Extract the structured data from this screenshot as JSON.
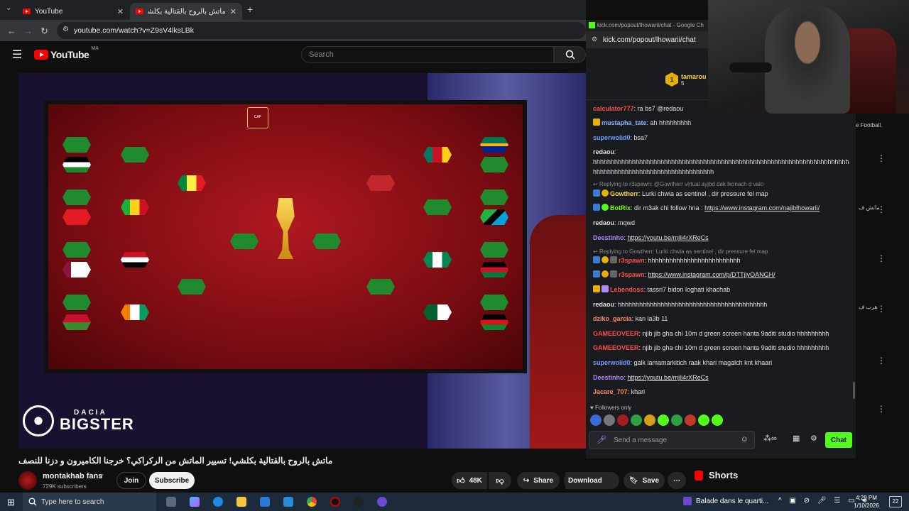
{
  "browser": {
    "tabs": [
      {
        "title": "YouTube"
      },
      {
        "title": "ماتش بالروح بالقتالية بكلشي! تس..."
      }
    ],
    "new_tab": "+",
    "url": "youtube.com/watch?v=Z9sV4lksLBk"
  },
  "youtube": {
    "logo": "YouTube",
    "country": "MA",
    "search_placeholder": "Search",
    "video": {
      "title": "ماتش بالروح بالقتالية بكلشي! تسيير الماتش من الركراكي؟ خرجنا الكاميرون و دزنا للنصف",
      "overlay_brand": "BIGSTER",
      "overlay_brand_small": "DACIA"
    },
    "channel": {
      "name": "montakhab fans",
      "subscribers": "729K subscribers"
    },
    "buttons": {
      "join": "Join",
      "subscribe": "Subscribe",
      "likes": "48K",
      "share": "Share",
      "download": "Download",
      "save": "Save"
    },
    "shorts_label": "Shorts"
  },
  "chat_window": {
    "title": "kick.com/popout/lhowarii/chat - Google Ch",
    "url": "kick.com/popout/lhowarii/chat",
    "top_user": {
      "name": "tamarou",
      "rank": "1",
      "count": "5"
    },
    "messages": [
      {
        "user": "calculator777",
        "color": "#ff4d4d",
        "text": "ra bs7 @redaou"
      },
      {
        "user": "mustapha_tate",
        "color": "#8ab4ff",
        "text": "ah hhhhhhhhh"
      },
      {
        "user": "superwolid0",
        "color": "#6f9dff",
        "text": "bsa7"
      },
      {
        "user": "redaou",
        "color": "#e0e0e0",
        "text": "hhhhhhhhhhhhhhhhhhhhhhhhhhhhhhhhhhhhhhhhhhhhhhhhhhhhhhhhhhhhhhhhhhhhhhhhhhhhhhhhhhhhhhhhhhhhhhhhhhhhhhhhhh"
      },
      {
        "reply": "Replying to r3spawn: @Gowtherr virtual ayjbd dak lkonach d valo",
        "user": "Gowtherr",
        "color": "#ffd54f",
        "text": "Lurki chwia as sentinel , dir pressure fel map"
      },
      {
        "user": "BotRix",
        "color": "#7cfc00",
        "text": "dir m3ak chi follow hna : ",
        "link": "https://www.instagram.com/najiblhowarii/"
      },
      {
        "user": "redaou",
        "color": "#e0e0e0",
        "text": "mqwd"
      },
      {
        "user": "Deestinho",
        "color": "#b388ff",
        "text": "",
        "link": "https://youtu.be/mjli4rXReCs"
      },
      {
        "reply": "Replying to Gowtherr: Lurki chwia as sentinel , dir pressure fel map",
        "user": "r3spawn",
        "color": "#ff4d4d",
        "text": "hhhhhhhhhhhhhhhhhhhhhhhhhh"
      },
      {
        "user": "r3spawn",
        "color": "#ff4d4d",
        "text": "",
        "link": "https://www.instagram.com/p/DTTjjyOANGH/"
      },
      {
        "user": "Lebendoss",
        "color": "#ff4d4d",
        "text": "tassri7 bidon loghati khachab"
      },
      {
        "user": "redaou",
        "color": "#e0e0e0",
        "text": "hhhhhhhhhhhhhhhhhhhhhhhhhhhhhhhhhhhhhhhhhh"
      },
      {
        "user": "dziko_garcia",
        "color": "#ff8a65",
        "text": "kan la3b 11"
      },
      {
        "user": "GAMEEOVEER",
        "color": "#ff4d4d",
        "text": "njib jib gha chi 10m d green screen hanta 9aditi studio hhhhhhhhh"
      },
      {
        "user": "GAMEEOVEER",
        "color": "#ff4d4d",
        "text": "njib jib gha chi 10m d green screen hanta 9aditi studio hhhhhhhhh"
      },
      {
        "user": "superwolid0",
        "color": "#6f9dff",
        "text": "galk lamamarkitich raak khari magalch knt khaari"
      },
      {
        "user": "Deestinho",
        "color": "#b388ff",
        "text": "",
        "link": "https://youtu.be/mjli4rXReCs"
      },
      {
        "user": "Jacare_707",
        "color": "#ff8a65",
        "text": "khari"
      }
    ],
    "followers_only": "Followers only",
    "input_placeholder": "Send a message",
    "chat_button": "Chat"
  },
  "right_column": {
    "snippet1": "e Football.",
    "snippet2": "ماتش ف",
    "snippet3": "هرب ف"
  },
  "taskbar": {
    "search_placeholder": "Type here to search",
    "media": "Balade dans le quarti...",
    "time": "4:29 PM",
    "date": "1/10/2026",
    "notifications": "22"
  }
}
